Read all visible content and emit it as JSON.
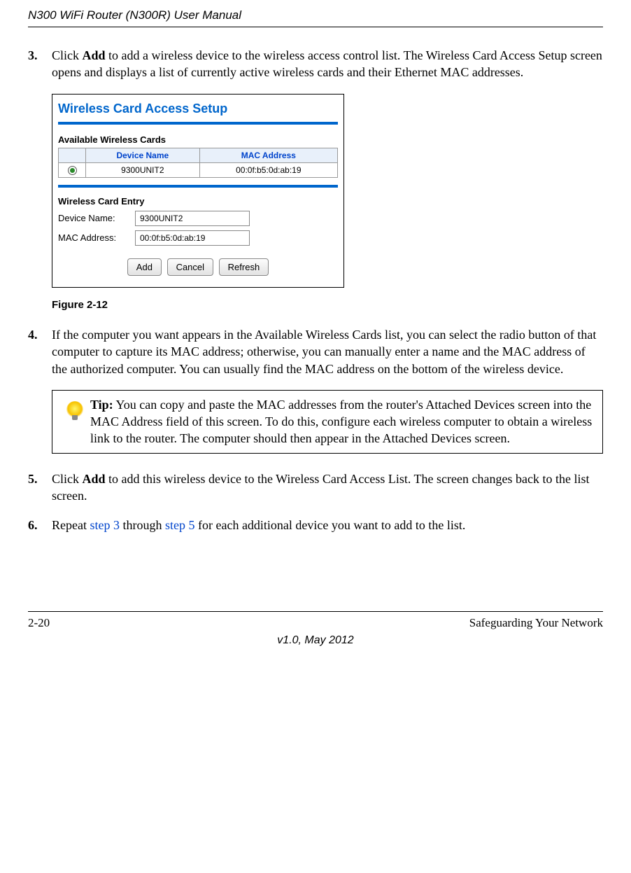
{
  "header": {
    "title": "N300 WiFi Router (N300R) User Manual"
  },
  "steps": {
    "s3_num": "3.",
    "s3_click": "Click ",
    "s3_add": "Add",
    "s3_rest": " to add a wireless device to the wireless access control list. The Wireless Card Access Setup screen opens and displays a list of currently active wireless cards and their Ethernet MAC addresses.",
    "s4_num": "4.",
    "s4_text": "If the computer you want appears in the Available Wireless Cards list, you can select the radio button of that computer to capture its MAC address; otherwise, you can manually enter a name and the MAC address of the authorized computer. You can usually find the MAC address on the bottom of the wireless device.",
    "s5_num": "5.",
    "s5_click": "Click ",
    "s5_add": "Add",
    "s5_rest": " to add this wireless device to the Wireless Card Access List. The screen changes back to the list screen.",
    "s6_num": "6.",
    "s6_pre": "Repeat ",
    "s6_link1": "step 3",
    "s6_mid": " through ",
    "s6_link2": "step 5",
    "s6_post": " for each additional device you want to add to the list."
  },
  "screenshot": {
    "title": "Wireless Card Access Setup",
    "available_label": "Available Wireless Cards",
    "col_device": "Device Name",
    "col_mac": "MAC Address",
    "row1_device": "9300UNIT2",
    "row1_mac": "00:0f:b5:0d:ab:19",
    "entry_label": "Wireless Card Entry",
    "device_name_label": "Device Name:",
    "device_name_value": "9300UNIT2",
    "mac_label": "MAC Address:",
    "mac_value": "00:0f:b5:0d:ab:19",
    "btn_add": "Add",
    "btn_cancel": "Cancel",
    "btn_refresh": "Refresh"
  },
  "figure_caption": "Figure 2-12",
  "tip": {
    "label": "Tip:",
    "text": " You can copy and paste the MAC addresses from the router's Attached Devices screen into the MAC Address field of this screen. To do this, configure each wireless computer to obtain a wireless link to the router. The computer should then appear in the Attached Devices screen."
  },
  "footer": {
    "page": "2-20",
    "section": "Safeguarding Your Network",
    "version": "v1.0, May 2012"
  }
}
